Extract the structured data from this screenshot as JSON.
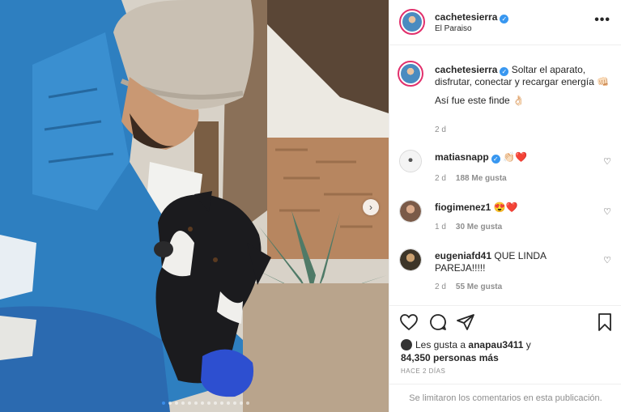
{
  "post": {
    "username": "cachetesierra",
    "location": "El Paraiso",
    "more_icon": "•••",
    "caption": {
      "username": "cachetesierra",
      "text_line1": "Soltar el aparato, disfrutar, conectar y recargar energía 👊🏻",
      "text_line2": "Así fue este finde 👌🏻",
      "time": "2 d"
    },
    "comments": [
      {
        "username": "matiasnapp",
        "verified": true,
        "text": "👏🏻❤️",
        "time": "2 d",
        "likes": "188 Me gusta"
      },
      {
        "username": "fiogimenez1",
        "verified": false,
        "text": "😍❤️",
        "time": "1 d",
        "likes": "30 Me gusta"
      },
      {
        "username": "eugeniafd41",
        "verified": false,
        "text": "QUE LINDA PAREJA!!!!!",
        "time": "2 d",
        "likes": "55 Me gusta"
      }
    ],
    "likes": {
      "prefix": "Les gusta a",
      "user": "anapau3411",
      "suffix": "y",
      "count": "84,350 personas más"
    },
    "time_ago": "HACE 2 DÍAS",
    "comments_limited": "Se limitaron los comentarios en esta publicación."
  },
  "carousel": {
    "total_slides": 14,
    "active_index": 0
  },
  "colors": {
    "verified": "#3897f0",
    "accent_dot": "#3b8eea",
    "muted": "#8e8e8e"
  }
}
